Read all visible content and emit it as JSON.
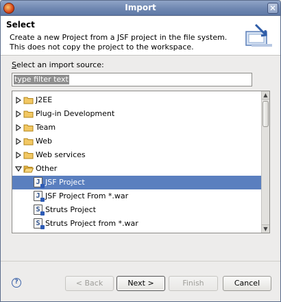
{
  "window": {
    "title": "Import"
  },
  "header": {
    "title": "Select",
    "description": "Create a new Project from a JSF project in the file system. This does not copy the project to the workspace."
  },
  "source": {
    "label_underlined": "S",
    "label_rest": "elect an import source:",
    "filter_value": "type filter text"
  },
  "tree": {
    "items": [
      {
        "label": "J2EE",
        "expanded": false,
        "icon": "folder-icon"
      },
      {
        "label": "Plug-in Development",
        "expanded": false,
        "icon": "folder-icon"
      },
      {
        "label": "Team",
        "expanded": false,
        "icon": "folder-icon"
      },
      {
        "label": "Web",
        "expanded": false,
        "icon": "folder-icon"
      },
      {
        "label": "Web services",
        "expanded": false,
        "icon": "folder-icon"
      },
      {
        "label": "Other",
        "expanded": true,
        "icon": "folder-open-icon"
      }
    ],
    "children": [
      {
        "label": "JSF Project",
        "selected": true,
        "icon": "jsf-project-icon"
      },
      {
        "label": "JSF Project From *.war",
        "selected": false,
        "icon": "jsf-war-icon"
      },
      {
        "label": "Struts Project",
        "selected": false,
        "icon": "struts-project-icon"
      },
      {
        "label": "Struts Project from *.war",
        "selected": false,
        "icon": "struts-war-icon"
      }
    ]
  },
  "buttons": {
    "back": "< Back",
    "next": "Next >",
    "finish": "Finish",
    "cancel": "Cancel",
    "help": "?"
  },
  "colors": {
    "selection": "#5a7fbf",
    "titlebar": "#6f87b1"
  }
}
